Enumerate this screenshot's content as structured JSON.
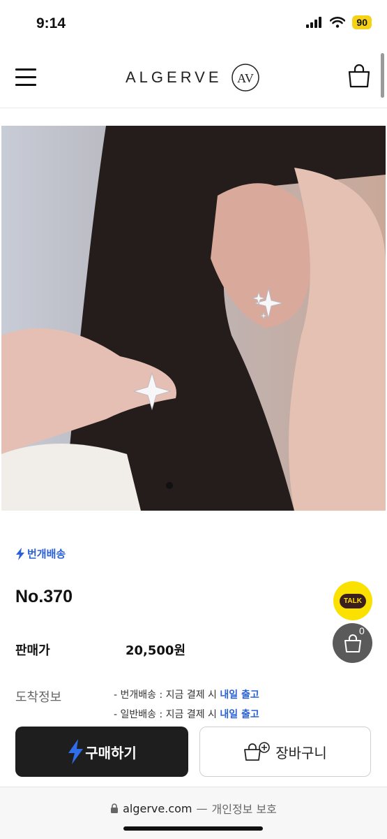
{
  "status_bar": {
    "time": "9:14",
    "battery": "90"
  },
  "header": {
    "logo": "ALGERVE",
    "logo_mark": "AV"
  },
  "product": {
    "delivery_tag": "번개배송",
    "name": "No.370",
    "price_label": "판매가",
    "price": "20,500원",
    "arrival_label": "도착정보",
    "arrival_lines": [
      {
        "prefix": "- 번개배송 : 지금 결제 시 ",
        "highlight": "내일 출고"
      },
      {
        "prefix": "- 일반배송 : 지금 결제 시 ",
        "highlight": "내일 출고"
      }
    ]
  },
  "floating": {
    "talk_label": "TALK",
    "cart_count": "0"
  },
  "actions": {
    "buy_label": "구매하기",
    "cart_label": "장바구니"
  },
  "browser": {
    "url": "algerve.com",
    "separator": "—",
    "privacy": "개인정보 보호"
  },
  "colors": {
    "accent_blue": "#2a61d6",
    "kakao_yellow": "#fbe100",
    "battery_yellow": "#f5d218"
  }
}
